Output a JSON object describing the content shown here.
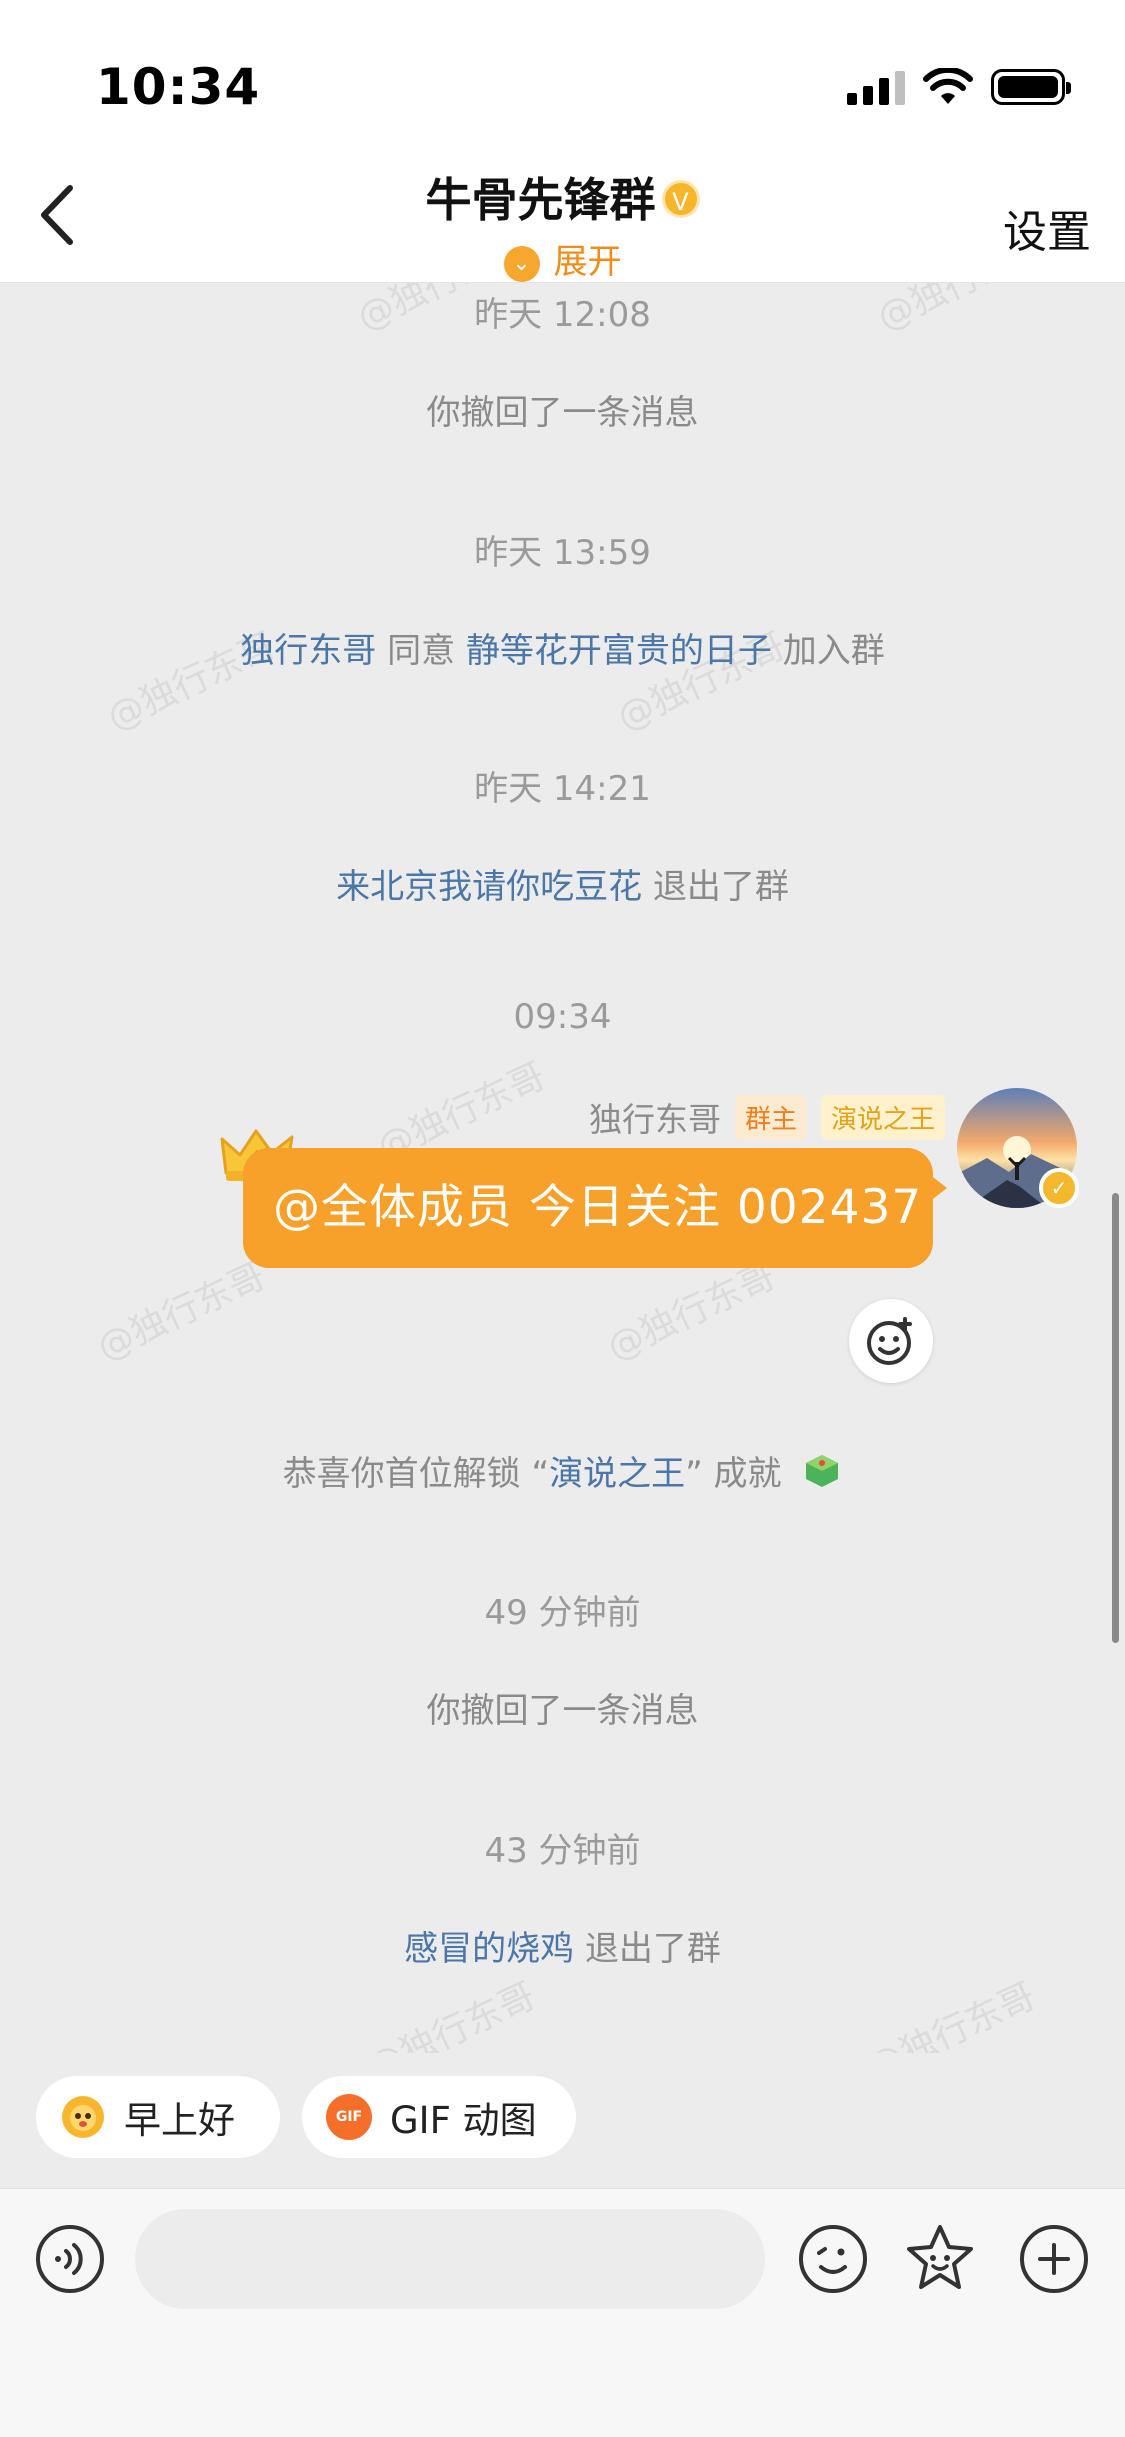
{
  "status_bar": {
    "time": "10:34",
    "battery_level": 1.0
  },
  "nav": {
    "title": "牛骨先锋群",
    "verified_mark": "V",
    "expand_label": "展开",
    "settings_label": "设置"
  },
  "chat": {
    "watermark": "@独行东哥",
    "messages": [
      {
        "type": "timestamp",
        "text": "昨天 12:08"
      },
      {
        "type": "system",
        "text": "你撤回了一条消息"
      },
      {
        "type": "timestamp",
        "text": "昨天 13:59"
      },
      {
        "type": "system",
        "actor": "独行东哥",
        "verb": "同意",
        "target": "静等花开富贵的日子",
        "suffix": "加入群"
      },
      {
        "type": "timestamp",
        "text": "昨天 14:21"
      },
      {
        "type": "system",
        "actor": "来北京我请你吃豆花",
        "suffix": "退出了群"
      },
      {
        "type": "timestamp",
        "text": "09:34"
      },
      {
        "type": "message",
        "sender": "独行东哥",
        "tags": [
          "群主",
          "演说之王"
        ],
        "text": "@全体成员 今日关注 002437"
      },
      {
        "type": "system",
        "prefix": "恭喜你首位解锁 “",
        "highlight": "演说之王",
        "suffix": "” 成就"
      },
      {
        "type": "timestamp",
        "text": "49 分钟前"
      },
      {
        "type": "system",
        "text": "你撤回了一条消息"
      },
      {
        "type": "timestamp",
        "text": "43 分钟前"
      },
      {
        "type": "system",
        "actor": "感冒的烧鸡",
        "suffix": "退出了群"
      }
    ]
  },
  "quick_replies": [
    {
      "label": "早上好",
      "icon": "sun-emoji-icon"
    },
    {
      "label": "GIF 动图",
      "icon": "gif-icon",
      "icon_text": "GIF"
    }
  ],
  "input": {
    "placeholder": ""
  },
  "colors": {
    "accent": "#f7a02a",
    "link": "#4a76a8",
    "background": "#ececec"
  }
}
